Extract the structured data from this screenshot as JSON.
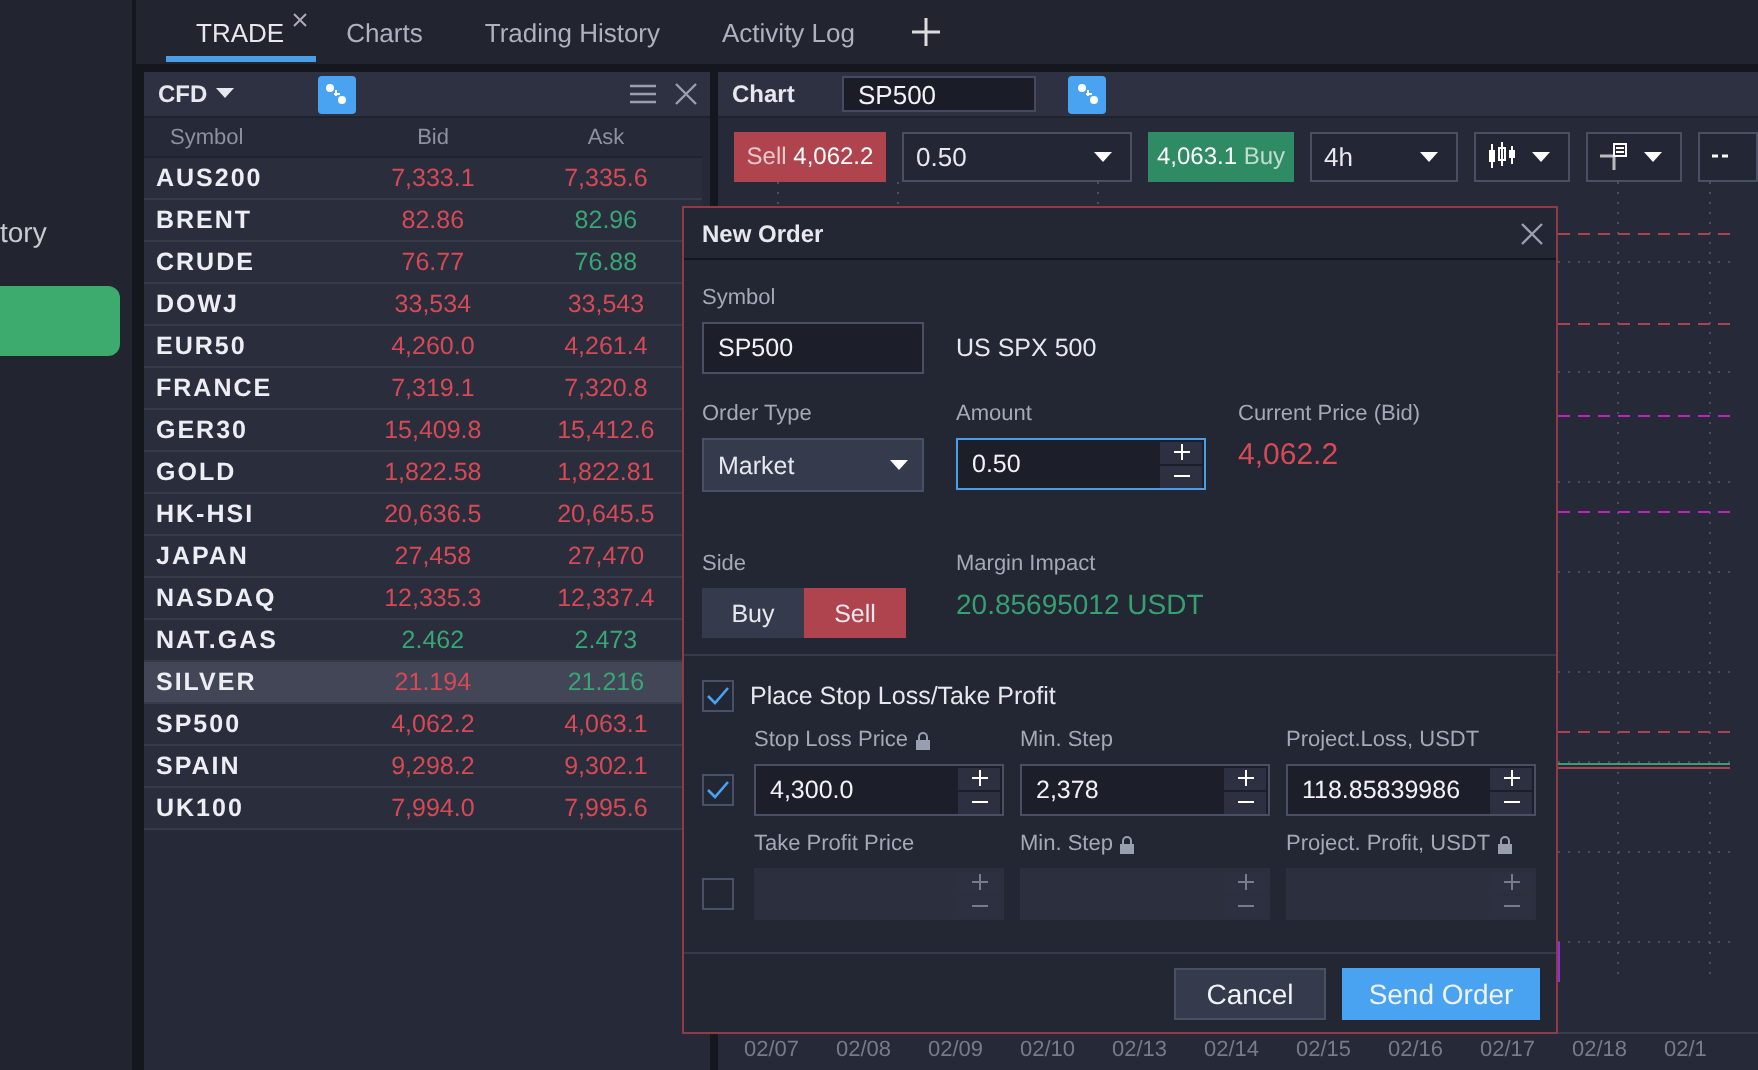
{
  "sidebar": {
    "item": "tory"
  },
  "tabs": [
    {
      "label": "TRADE",
      "selected": true,
      "closable": true
    },
    {
      "label": "Charts",
      "selected": false,
      "closable": false
    },
    {
      "label": "Trading History",
      "selected": false,
      "closable": false
    },
    {
      "label": "Activity Log",
      "selected": false,
      "closable": false
    }
  ],
  "watchlist": {
    "title": "CFD",
    "columns": [
      "Symbol",
      "Bid",
      "Ask"
    ],
    "rows": [
      {
        "symbol": "AUS200",
        "bid": "7,333.1",
        "ask": "7,335.6",
        "bid_up": false,
        "ask_up": false,
        "selected": false
      },
      {
        "symbol": "BRENT",
        "bid": "82.86",
        "ask": "82.96",
        "bid_up": false,
        "ask_up": true,
        "selected": false
      },
      {
        "symbol": "CRUDE",
        "bid": "76.77",
        "ask": "76.88",
        "bid_up": false,
        "ask_up": true,
        "selected": false
      },
      {
        "symbol": "DOWJ",
        "bid": "33,534",
        "ask": "33,543",
        "bid_up": false,
        "ask_up": false,
        "selected": false
      },
      {
        "symbol": "EUR50",
        "bid": "4,260.0",
        "ask": "4,261.4",
        "bid_up": false,
        "ask_up": false,
        "selected": false
      },
      {
        "symbol": "FRANCE",
        "bid": "7,319.1",
        "ask": "7,320.8",
        "bid_up": false,
        "ask_up": false,
        "selected": false
      },
      {
        "symbol": "GER30",
        "bid": "15,409.8",
        "ask": "15,412.6",
        "bid_up": false,
        "ask_up": false,
        "selected": false
      },
      {
        "symbol": "GOLD",
        "bid": "1,822.58",
        "ask": "1,822.81",
        "bid_up": false,
        "ask_up": false,
        "selected": false
      },
      {
        "symbol": "HK-HSI",
        "bid": "20,636.5",
        "ask": "20,645.5",
        "bid_up": false,
        "ask_up": false,
        "selected": false
      },
      {
        "symbol": "JAPAN",
        "bid": "27,458",
        "ask": "27,470",
        "bid_up": false,
        "ask_up": false,
        "selected": false
      },
      {
        "symbol": "NASDAQ",
        "bid": "12,335.3",
        "ask": "12,337.4",
        "bid_up": false,
        "ask_up": false,
        "selected": false
      },
      {
        "symbol": "NAT.GAS",
        "bid": "2.462",
        "ask": "2.473",
        "bid_up": true,
        "ask_up": true,
        "selected": false
      },
      {
        "symbol": "SILVER",
        "bid": "21.194",
        "ask": "21.216",
        "bid_up": false,
        "ask_up": true,
        "selected": true
      },
      {
        "symbol": "SP500",
        "bid": "4,062.2",
        "ask": "4,063.1",
        "bid_up": false,
        "ask_up": false,
        "selected": false
      },
      {
        "symbol": "SPAIN",
        "bid": "9,298.2",
        "ask": "9,302.1",
        "bid_up": false,
        "ask_up": false,
        "selected": false
      },
      {
        "symbol": "UK100",
        "bid": "7,994.0",
        "ask": "7,995.6",
        "bid_up": false,
        "ask_up": false,
        "selected": false
      }
    ]
  },
  "chart": {
    "title": "Chart",
    "symbol": "SP500",
    "sell_label": "Sell",
    "sell_price": "4,062.2",
    "amount": "0.50",
    "buy_price": "4,063.1",
    "buy_label": "Buy",
    "interval": "4h",
    "dates": [
      "02/07",
      "02/08",
      "02/09",
      "02/10",
      "02/13",
      "02/14",
      "02/15",
      "02/16",
      "02/17",
      "02/18",
      "02/1"
    ]
  },
  "dialog": {
    "title": "New Order",
    "symbol_label": "Symbol",
    "symbol": "SP500",
    "symbol_name": "US SPX 500",
    "order_type_label": "Order Type",
    "order_type": "Market",
    "amount_label": "Amount",
    "amount": "0.50",
    "price_label": "Current Price (Bid)",
    "price": "4,062.2",
    "side_label": "Side",
    "sides": [
      {
        "label": "Buy",
        "selected": false
      },
      {
        "label": "Sell",
        "selected": true
      }
    ],
    "margin_label": "Margin Impact",
    "margin": "20.85695012 USDT",
    "sltp": {
      "label": "Place Stop Loss/Take Profit",
      "checked": true
    },
    "rows": [
      {
        "checked": true,
        "fields": [
          {
            "label": "Stop Loss Price",
            "locked": true,
            "value": "4,300.0"
          },
          {
            "label": "Min. Step",
            "locked": false,
            "value": "2,378"
          },
          {
            "label": "Project.Loss, USDT",
            "locked": false,
            "value": "118.85839986"
          }
        ]
      },
      {
        "checked": false,
        "fields": [
          {
            "label": "Take Profit Price",
            "locked": false
          },
          {
            "label": "Min. Step",
            "locked": true
          },
          {
            "label": "Project. Profit, USDT",
            "locked": true
          }
        ]
      }
    ],
    "cancel": "Cancel",
    "submit": "Send Order"
  }
}
